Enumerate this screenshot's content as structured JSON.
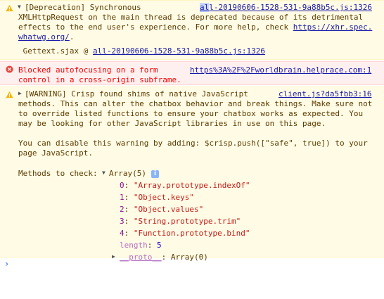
{
  "messages": {
    "deprecation": {
      "icon": "warning-icon",
      "line1": "[Deprecation] Synchronous",
      "source_hl": "al",
      "source_rest": "l-20190606-1528-531-9a88b5c.js:1326",
      "line2": "XMLHttpRequest on the main thread is deprecated because of its detrimental",
      "line3": "effects to the end user's experience. For more help, check ",
      "line3_link": "https://xhr.spec.",
      "line4_link": "whatwg.org/",
      "line4_tail": ".",
      "stack_prefix": " Gettext.sjax @ ",
      "stack_link": "all-20190606-1528-531-9a88b5c.js:1326"
    },
    "error": {
      "icon": "error-icon",
      "line1": "Blocked autofocusing on a form",
      "source": "https%3A%2F%2Fworldbrain.helprace.com:1",
      "line2": "control in a cross-origin subframe."
    },
    "crisp": {
      "icon": "warning-icon",
      "line1": "[WARNING] Crisp found shims of native JavaScript",
      "source": "client.js?da5fbb3:16",
      "line2": "methods. This can alter the chatbox behavior and break things. Make sure not",
      "line3": "to override listed functions to ensure your chatbox works as expected. You",
      "line4": "may be looking for other JavaScript libraries in use on this page.",
      "line5": "You can disable this warning by adding: $crisp.push([\"safe\", true]) to your",
      "line6": "page JavaScript.",
      "methods_label": "Methods to check: ",
      "array_label": "Array(5)",
      "info_badge": "i",
      "items": [
        {
          "key": "0",
          "value": "\"Array.prototype.indexOf\""
        },
        {
          "key": "1",
          "value": "\"Object.keys\""
        },
        {
          "key": "2",
          "value": "\"Object.values\""
        },
        {
          "key": "3",
          "value": "\"String.prototype.trim\""
        },
        {
          "key": "4",
          "value": "\"Function.prototype.bind\""
        }
      ],
      "length_key": "length",
      "length_value": "5",
      "proto_key": "__proto__",
      "proto_value": "Array(0)"
    }
  },
  "console": {
    "prompt_icon": "chevron-right-icon",
    "prompt_symbol": "›"
  },
  "colors": {
    "warning_bg": "#fffbe5",
    "error_bg": "#fff0f0",
    "link": "#1a1aa6",
    "key": "#881391",
    "string": "#c41a16",
    "number": "#1c00cf",
    "error_text": "#ff0000"
  }
}
